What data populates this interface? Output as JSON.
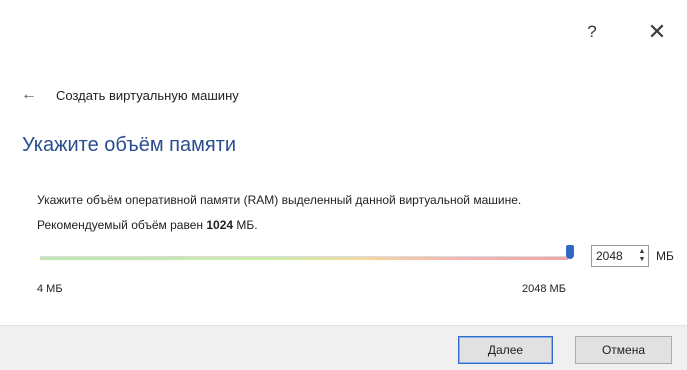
{
  "window": {
    "help_label": "?",
    "close_label": "✕"
  },
  "nav": {
    "back_icon": "←",
    "wizard_title": "Создать виртуальную машину"
  },
  "page": {
    "title": "Укажите объём памяти",
    "description": "Укажите объём оперативной памяти (RAM) выделенный данной виртуальной машине.",
    "recommended_prefix": "Рекомендуемый объём равен ",
    "recommended_value": "1024",
    "recommended_suffix": " МБ."
  },
  "memory": {
    "value": "2048",
    "unit": "МБ",
    "min_label": "4 МБ",
    "max_label": "2048 МБ",
    "slider_level": 1.0
  },
  "footer": {
    "next_label": "Далее",
    "cancel_label": "Отмена"
  },
  "colors": {
    "title_blue": "#2a4d8f",
    "accent": "#2d69c4"
  }
}
